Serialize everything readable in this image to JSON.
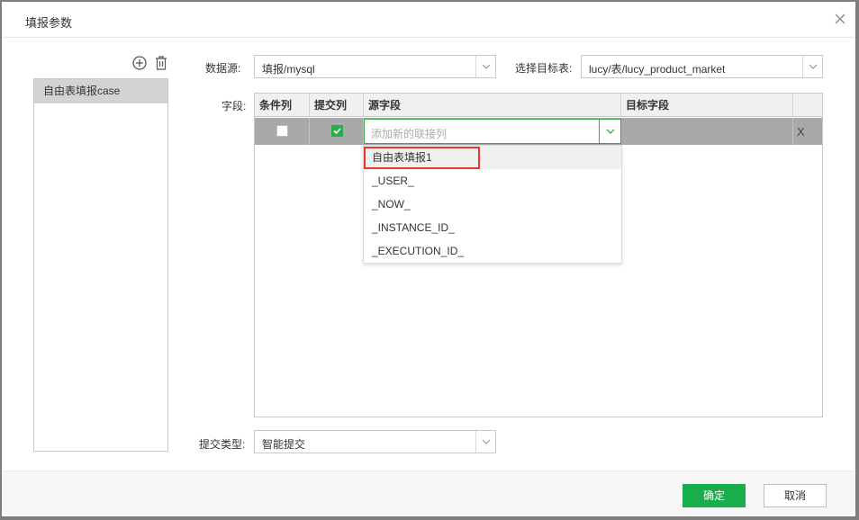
{
  "dialog": {
    "title": "填报参数"
  },
  "sidebar": {
    "items": [
      {
        "label": "自由表填报case"
      }
    ]
  },
  "form": {
    "datasource": {
      "label": "数据源:",
      "value": "填报/mysql"
    },
    "target_table": {
      "label": "选择目标表:",
      "value": "lucy/表/lucy_product_market"
    },
    "fields_label": "字段:",
    "submit_type": {
      "label": "提交类型:",
      "value": "智能提交"
    }
  },
  "grid": {
    "columns": [
      "条件列",
      "提交列",
      "源字段",
      "目标字段"
    ],
    "rows": [
      {
        "condition_checked": false,
        "submit_checked": true,
        "source_placeholder": "添加新的联接列",
        "target": "",
        "delete_label": "X"
      }
    ]
  },
  "dropdown": {
    "options": [
      "自由表填报1",
      "_USER_",
      "_NOW_",
      "_INSTANCE_ID_",
      "_EXECUTION_ID_"
    ],
    "highlighted_index": 0
  },
  "footer": {
    "ok_label": "确定",
    "cancel_label": "取消"
  },
  "colors": {
    "accent": "#1aad4b",
    "highlight_border": "#e53935",
    "row_bg": "#a9a9a9"
  }
}
